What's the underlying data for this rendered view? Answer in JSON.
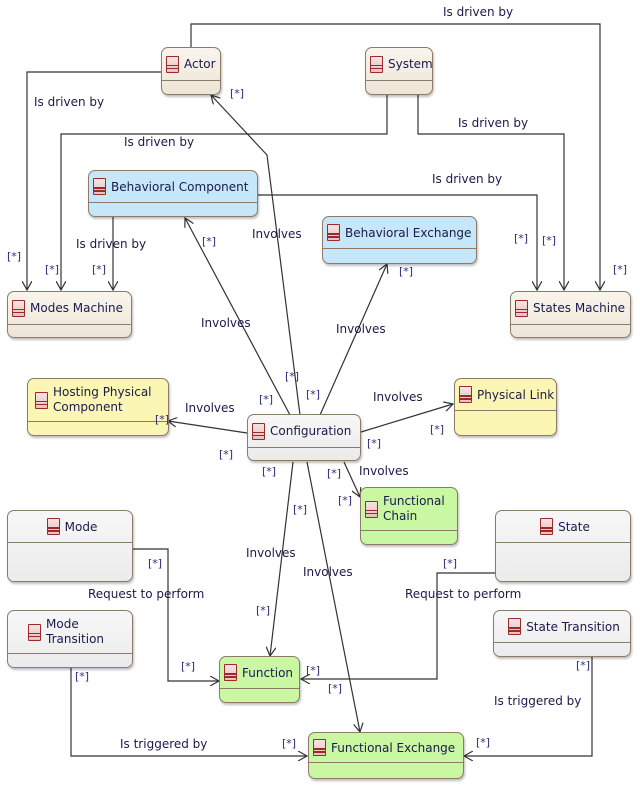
{
  "nodes": {
    "actor": "Actor",
    "system": "System",
    "behavioral_component": "Behavioral Component",
    "behavioral_exchange": "Behavioral Exchange",
    "modes_machine": "Modes Machine",
    "states_machine": "States Machine",
    "hosting_physical_component": "Hosting Physical Component",
    "configuration": "Configuration",
    "physical_link": "Physical Link",
    "functional_chain": "Functional Chain",
    "mode": "Mode",
    "state": "State",
    "mode_transition": "Mode Transition",
    "state_transition": "State Transition",
    "function": "Function",
    "functional_exchange": "Functional Exchange"
  },
  "relations": {
    "is_driven_by": "Is driven by",
    "involves": "Involves",
    "request_to_perform": "Request to perform",
    "is_triggered_by": "Is triggered by"
  },
  "multiplicity": "[*]",
  "colors": {
    "abstract": "#ede5d6",
    "behavioral": "#c6e6fa",
    "physical": "#fcf6b4",
    "functional": "#c9f7a2",
    "mode_state": "#ebebeb"
  }
}
